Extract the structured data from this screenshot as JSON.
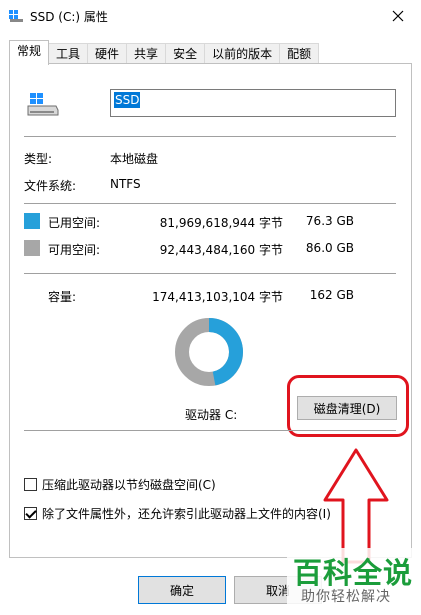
{
  "window": {
    "title": "SSD (C:) 属性",
    "close_icon": "close-icon"
  },
  "tabs": [
    {
      "label": "常规",
      "active": true
    },
    {
      "label": "工具"
    },
    {
      "label": "硬件"
    },
    {
      "label": "共享"
    },
    {
      "label": "安全"
    },
    {
      "label": "以前的版本"
    },
    {
      "label": "配额"
    }
  ],
  "general": {
    "drive_name": "SSD",
    "type_label": "类型:",
    "type_value": "本地磁盘",
    "fs_label": "文件系统:",
    "fs_value": "NTFS",
    "used_label": "已用空间:",
    "used_bytes": "81,969,618,944 字节",
    "used_size": "76.3 GB",
    "free_label": "可用空间:",
    "free_bytes": "92,443,484,160 字节",
    "free_size": "86.0 GB",
    "capacity_label": "容量:",
    "capacity_bytes": "174,413,103,104 字节",
    "capacity_size": "162 GB",
    "drive_label": "驱动器 C:",
    "cleanup_button": "磁盘清理(D)",
    "compress_label": "压缩此驱动器以节约磁盘空间(C)",
    "compress_checked": false,
    "index_label": "除了文件属性外，还允许索引此驱动器上文件的内容(I)",
    "index_checked": true,
    "used_fraction": 0.47
  },
  "buttons": {
    "ok": "确定",
    "cancel": "取消"
  },
  "colors": {
    "used": "#26a0da",
    "free": "#a7a7a7",
    "annotation": "#e0141e",
    "selection": "#0078d7"
  },
  "watermark": {
    "main": "百科全说",
    "sub": "助你轻松解决"
  }
}
